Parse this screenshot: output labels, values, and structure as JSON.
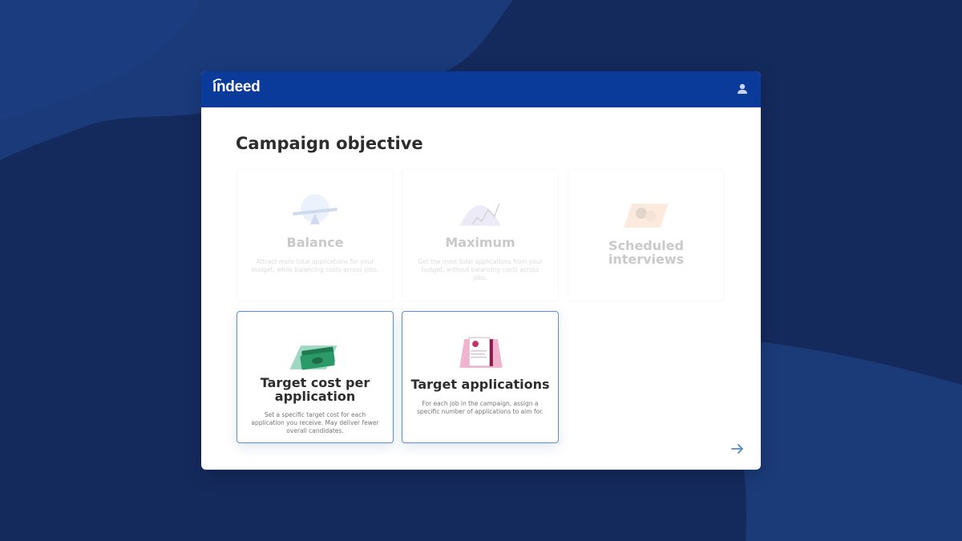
{
  "brand": {
    "logo_text": "indeed"
  },
  "page": {
    "title": "Campaign objective"
  },
  "objectives": [
    {
      "key": "balance",
      "title": "Balance",
      "description": "Attract more total applications for your budget, while balancing costs across jobs.",
      "state": "disabled"
    },
    {
      "key": "maximum",
      "title": "Maximum",
      "description": "Get the most total applications from your budget, without balancing costs across jobs.",
      "state": "disabled"
    },
    {
      "key": "scheduled_interviews",
      "title": "Scheduled interviews",
      "description": "",
      "state": "disabled"
    },
    {
      "key": "target_cost",
      "title": "Target cost per application",
      "description": "Set a specific target cost for each application you receive. May deliver fewer overall candidates.",
      "state": "enabled"
    },
    {
      "key": "target_applications",
      "title": "Target applications",
      "description": "For each job in the campaign, assign a specific number of applications to aim for.",
      "state": "enabled"
    }
  ],
  "icons": {
    "user": "user-icon",
    "next": "arrow-right-icon"
  },
  "colors": {
    "header": "#0a3a9a",
    "accent": "#5b8ed6",
    "background": "#142a5c"
  }
}
